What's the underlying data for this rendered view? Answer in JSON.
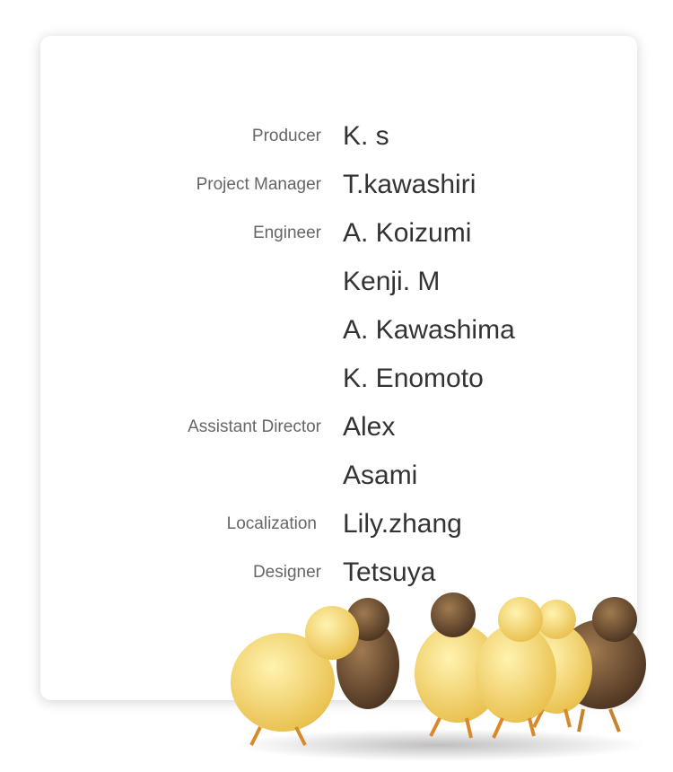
{
  "credits": [
    {
      "role": "Producer",
      "name": "K. s"
    },
    {
      "role": "Project Manager",
      "name": "T.kawashiri"
    },
    {
      "role": "Engineer",
      "name": "A. Koizumi"
    },
    {
      "role": "",
      "name": "Kenji. M"
    },
    {
      "role": "",
      "name": "A. Kawashima"
    },
    {
      "role": "",
      "name": "K. Enomoto"
    },
    {
      "role": "Assistant Director",
      "name": "Alex"
    },
    {
      "role": "",
      "name": "Asami"
    },
    {
      "role": "Localization",
      "name": "Lily.zhang"
    },
    {
      "role": "Designer",
      "name": "Tetsuya"
    }
  ]
}
